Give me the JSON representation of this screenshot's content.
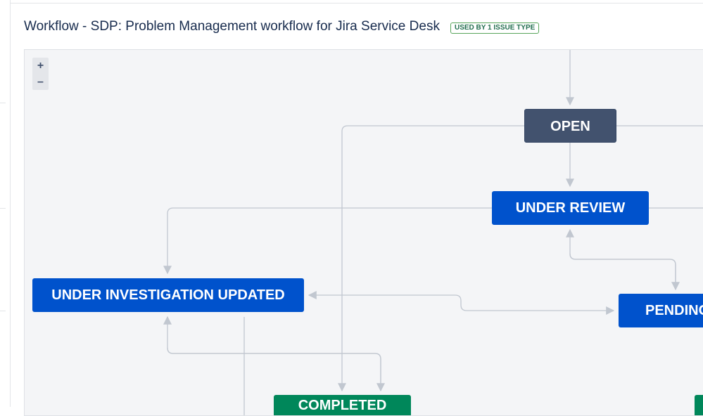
{
  "header": {
    "title": "Workflow - SDP: Problem Management workflow for Jira Service Desk",
    "badge": "USED BY 1 ISSUE TYPE"
  },
  "zoom": {
    "in_label": "+",
    "out_label": "–"
  },
  "statuses": {
    "open": "OPEN",
    "under_review": "UNDER REVIEW",
    "under_investigation": "UNDER INVESTIGATION UPDATED",
    "pending": "PENDING",
    "completed": "COMPLETED"
  },
  "colors": {
    "todo": "#42526e",
    "in_progress": "#0052cc",
    "done": "#00875a",
    "badge_border": "#57a55a"
  }
}
